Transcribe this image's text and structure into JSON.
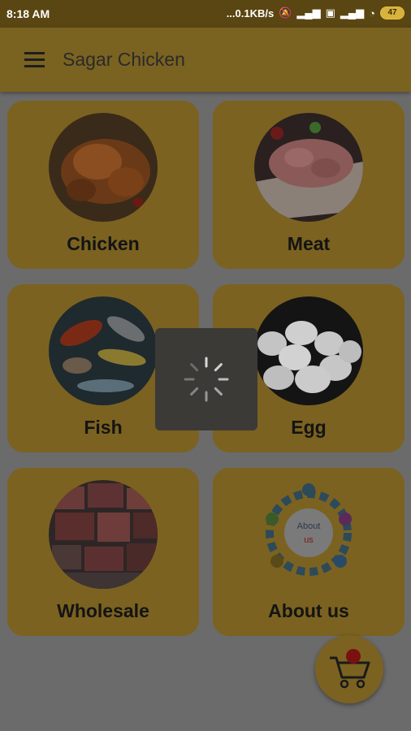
{
  "status_bar": {
    "time": "8:18 AM",
    "speed": "...0.1KB/s",
    "battery": "47"
  },
  "app_bar": {
    "title": "Sagar Chicken",
    "menu_icon": "hamburger-icon"
  },
  "categories": [
    {
      "label": "Chicken",
      "image": "roast-chicken-photo"
    },
    {
      "label": "Meat",
      "image": "raw-meat-photo"
    },
    {
      "label": "Fish",
      "image": "seafood-photo"
    },
    {
      "label": "Egg",
      "image": "eggs-photo"
    },
    {
      "label": "Wholesale",
      "image": "meat-cuts-photo"
    },
    {
      "label": "About us",
      "image": "about-us-illustration",
      "image_text": [
        "About",
        "us"
      ]
    }
  ],
  "loading": {
    "icon": "spinner-icon"
  },
  "cart": {
    "icon": "shopping-cart-icon"
  },
  "colors": {
    "card": "#7b6220",
    "app_bar": "#7a6220",
    "overlay": "#6b6b6b"
  }
}
